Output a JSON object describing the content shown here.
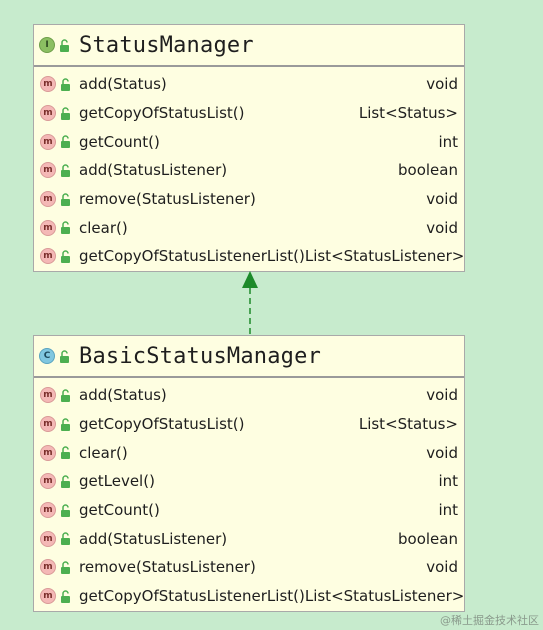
{
  "colors": {
    "background": "#c7ebcd",
    "box_fill": "#fefee1",
    "box_border": "#a9a9a9",
    "arrow": "#1d8a2a",
    "interface_badge": "#8bbf62",
    "class_badge": "#80c7e0",
    "method_icon": "#f4b8b6",
    "lock": "#4caf50"
  },
  "interface": {
    "kind_letter": "I",
    "kind_icon": "interface-icon",
    "visibility_icon": "lock-open-icon",
    "name": "StatusManager",
    "members": [
      {
        "icon_letter": "m",
        "name": "add(Status)",
        "type": "void"
      },
      {
        "icon_letter": "m",
        "name": "getCopyOfStatusList()",
        "type": "List<Status>"
      },
      {
        "icon_letter": "m",
        "name": "getCount()",
        "type": "int"
      },
      {
        "icon_letter": "m",
        "name": "add(StatusListener)",
        "type": "boolean"
      },
      {
        "icon_letter": "m",
        "name": "remove(StatusListener)",
        "type": "void"
      },
      {
        "icon_letter": "m",
        "name": "clear()",
        "type": "void"
      },
      {
        "icon_letter": "m",
        "name": "getCopyOfStatusListenerList()",
        "type": "List<StatusListener>"
      }
    ]
  },
  "class": {
    "kind_letter": "C",
    "kind_icon": "class-icon",
    "visibility_icon": "lock-open-icon",
    "name": "BasicStatusManager",
    "members": [
      {
        "icon_letter": "m",
        "name": "add(Status)",
        "type": "void"
      },
      {
        "icon_letter": "m",
        "name": "getCopyOfStatusList()",
        "type": "List<Status>"
      },
      {
        "icon_letter": "m",
        "name": "clear()",
        "type": "void"
      },
      {
        "icon_letter": "m",
        "name": "getLevel()",
        "type": "int"
      },
      {
        "icon_letter": "m",
        "name": "getCount()",
        "type": "int"
      },
      {
        "icon_letter": "m",
        "name": "add(StatusListener)",
        "type": "boolean"
      },
      {
        "icon_letter": "m",
        "name": "remove(StatusListener)",
        "type": "void"
      },
      {
        "icon_letter": "m",
        "name": "getCopyOfStatusListenerList()",
        "type": "List<StatusListener>"
      }
    ]
  },
  "relation": {
    "kind": "realization",
    "from": "BasicStatusManager",
    "to": "StatusManager"
  },
  "watermark": "@稀土掘金技术社区"
}
